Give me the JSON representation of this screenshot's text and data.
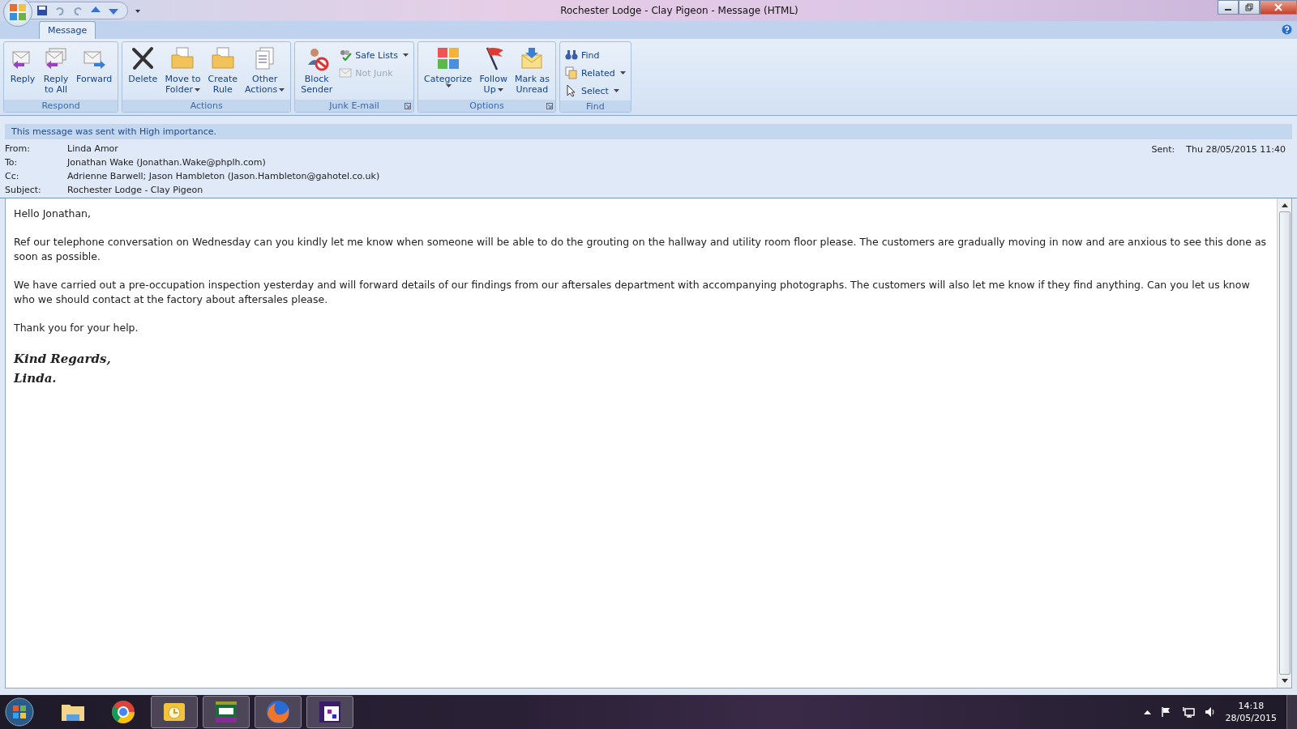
{
  "window": {
    "title": "Rochester Lodge - Clay Pigeon - Message (HTML)"
  },
  "tabs": [
    {
      "label": "Message",
      "selected": true
    }
  ],
  "ribbon": {
    "groups": [
      {
        "label": "Respond",
        "launcher": false,
        "buttons": [
          {
            "kind": "large",
            "lines": [
              "Reply"
            ],
            "dropdown": false,
            "disabled": false
          },
          {
            "kind": "large",
            "lines": [
              "Reply",
              "to All"
            ],
            "dropdown": false,
            "disabled": false
          },
          {
            "kind": "large",
            "lines": [
              "Forward"
            ],
            "dropdown": false,
            "disabled": false
          }
        ]
      },
      {
        "label": "Actions",
        "launcher": false,
        "buttons": [
          {
            "kind": "large",
            "lines": [
              "Delete"
            ],
            "dropdown": false,
            "disabled": false
          },
          {
            "kind": "large",
            "lines": [
              "Move to",
              "Folder"
            ],
            "dropdown": true,
            "disabled": false
          },
          {
            "kind": "large",
            "lines": [
              "Create",
              "Rule"
            ],
            "dropdown": false,
            "disabled": false
          },
          {
            "kind": "large",
            "lines": [
              "Other",
              "Actions"
            ],
            "dropdown": true,
            "disabled": false
          }
        ]
      },
      {
        "label": "Junk E-mail",
        "launcher": true,
        "buttons": [
          {
            "kind": "large",
            "lines": [
              "Block",
              "Sender"
            ],
            "dropdown": false,
            "disabled": false
          },
          {
            "kind": "small",
            "lines": [
              "Safe Lists"
            ],
            "dropdown": true,
            "disabled": false
          },
          {
            "kind": "small",
            "lines": [
              "Not Junk"
            ],
            "dropdown": false,
            "disabled": true
          }
        ]
      },
      {
        "label": "Options",
        "launcher": true,
        "buttons": [
          {
            "kind": "large",
            "lines": [
              "Categorize"
            ],
            "dropdown": true,
            "disabled": false
          },
          {
            "kind": "large",
            "lines": [
              "Follow",
              "Up"
            ],
            "dropdown": true,
            "disabled": false
          },
          {
            "kind": "large",
            "lines": [
              "Mark as",
              "Unread"
            ],
            "dropdown": false,
            "disabled": false
          }
        ]
      },
      {
        "label": "Find",
        "launcher": false,
        "buttons": [
          {
            "kind": "small",
            "lines": [
              "Find"
            ],
            "dropdown": false,
            "disabled": false
          },
          {
            "kind": "small",
            "lines": [
              "Related"
            ],
            "dropdown": true,
            "disabled": false
          },
          {
            "kind": "small",
            "lines": [
              "Select"
            ],
            "dropdown": true,
            "disabled": false
          }
        ]
      }
    ]
  },
  "message": {
    "importance_banner": "This message was sent with High importance.",
    "fields": [
      {
        "label": "From:",
        "value": "Linda Amor"
      },
      {
        "label": "To:",
        "value": "Jonathan Wake (Jonathan.Wake@phplh.com)"
      },
      {
        "label": "Cc:",
        "value": "Adrienne Barwell; Jason Hambleton (Jason.Hambleton@gahotel.co.uk)"
      },
      {
        "label": "Subject:",
        "value": "Rochester Lodge - Clay Pigeon"
      }
    ],
    "sent": {
      "label": "Sent:",
      "value": "Thu 28/05/2015 11:40"
    },
    "body": [
      "Hello Jonathan,",
      "Ref our telephone conversation on Wednesday can you kindly let me know when someone will be able to do the grouting on the hallway and utility room floor please.  The customers are gradually moving in now and are anxious to see this done as soon as possible.",
      "We have carried out a pre-occupation inspection yesterday and will forward details of our findings from our aftersales department with accompanying photographs.  The customers will also let me know if they find anything.  Can you let us know who we should contact at the factory about aftersales please.",
      "Thank you for your help."
    ],
    "signature": [
      "Kind Regards,",
      "Linda."
    ]
  },
  "taskbar": {
    "apps": [
      {
        "open": false
      },
      {
        "open": false
      },
      {
        "open": true
      },
      {
        "open": true
      },
      {
        "open": true
      },
      {
        "open": true
      }
    ],
    "time": "14:18",
    "date": "28/05/2015"
  }
}
